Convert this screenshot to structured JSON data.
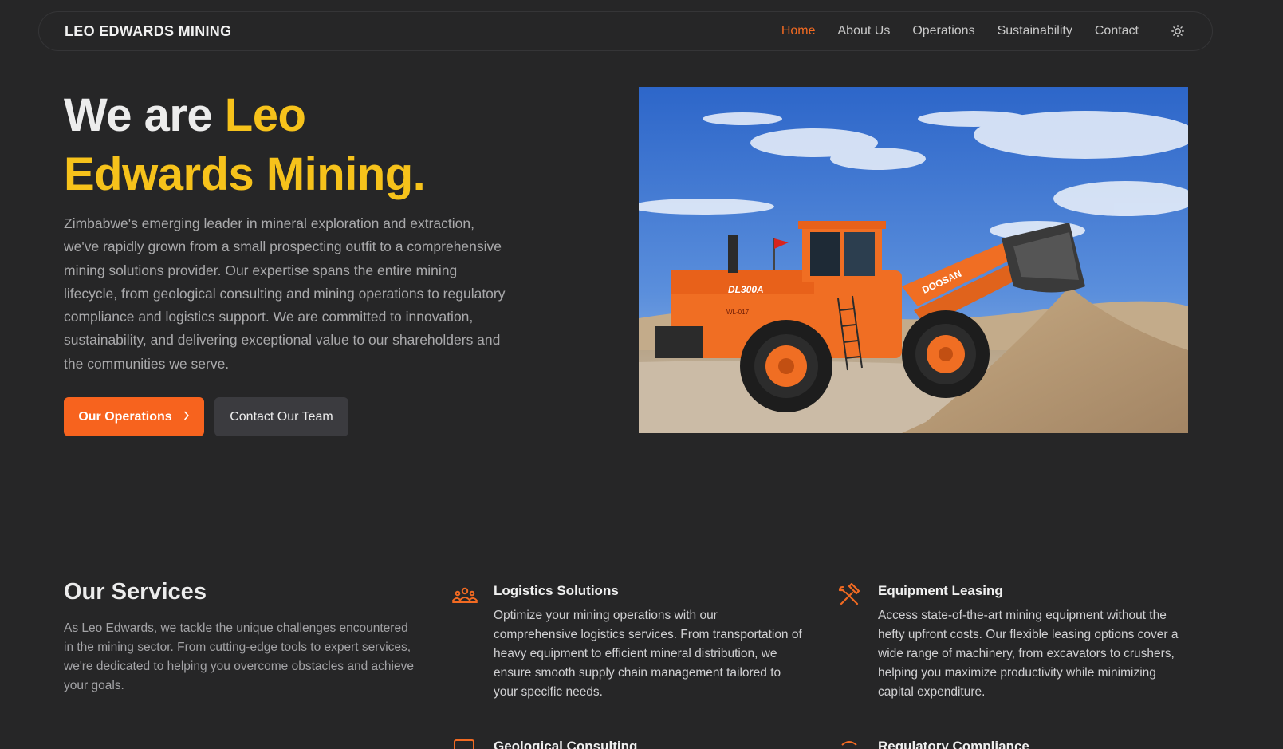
{
  "nav": {
    "brand": "LEO EDWARDS MINING",
    "links": [
      {
        "label": "Home",
        "active": true
      },
      {
        "label": "About Us"
      },
      {
        "label": "Operations"
      },
      {
        "label": "Sustainability"
      },
      {
        "label": "Contact"
      }
    ],
    "theme_icon": "sun-icon"
  },
  "hero": {
    "title_plain": "We are ",
    "title_accent_1": "Leo",
    "title_accent_2": "Edwards Mining.",
    "description": "Zimbabwe's emerging leader in mineral exploration and extraction, we've rapidly grown from a small prospecting outfit to a comprehensive mining solutions provider. Our expertise spans the entire mining lifecycle, from geological consulting and mining operations to regulatory compliance and logistics support. We are committed to innovation, sustainability, and delivering exceptional value to our shareholders and the communities we serve.",
    "primary_button": "Our Operations",
    "secondary_button": "Contact Our Team",
    "image_model_label": "DL300A",
    "image_brand_label": "DOOSAN",
    "image_plate_label": "WL-017"
  },
  "services": {
    "title": "Our Services",
    "description": "As Leo Edwards, we tackle the unique challenges encountered in the mining sector. From cutting-edge tools to expert services, we're dedicated to helping you overcome obstacles and achieve your goals.",
    "items": [
      {
        "title": "Logistics Solutions",
        "icon": "team-icon",
        "description": "Optimize your mining operations with our comprehensive logistics services. From transportation of heavy equipment to efficient mineral distribution, we ensure smooth supply chain management tailored to your specific needs."
      },
      {
        "title": "Equipment Leasing",
        "icon": "tools-icon",
        "description": "Access state-of-the-art mining equipment without the hefty upfront costs. Our flexible leasing options cover a wide range of machinery, from excavators to crushers, helping you maximize productivity while minimizing capital expenditure."
      },
      {
        "title": "Geological Consulting",
        "icon": "monitor-icon"
      },
      {
        "title": "Regulatory Compliance",
        "icon": "shield-icon"
      }
    ]
  },
  "colors": {
    "background": "#262627",
    "accent_orange": "#f26a22",
    "accent_yellow": "#f6c21b",
    "button_primary": "#f7631e",
    "button_secondary": "#3b3b3f"
  }
}
